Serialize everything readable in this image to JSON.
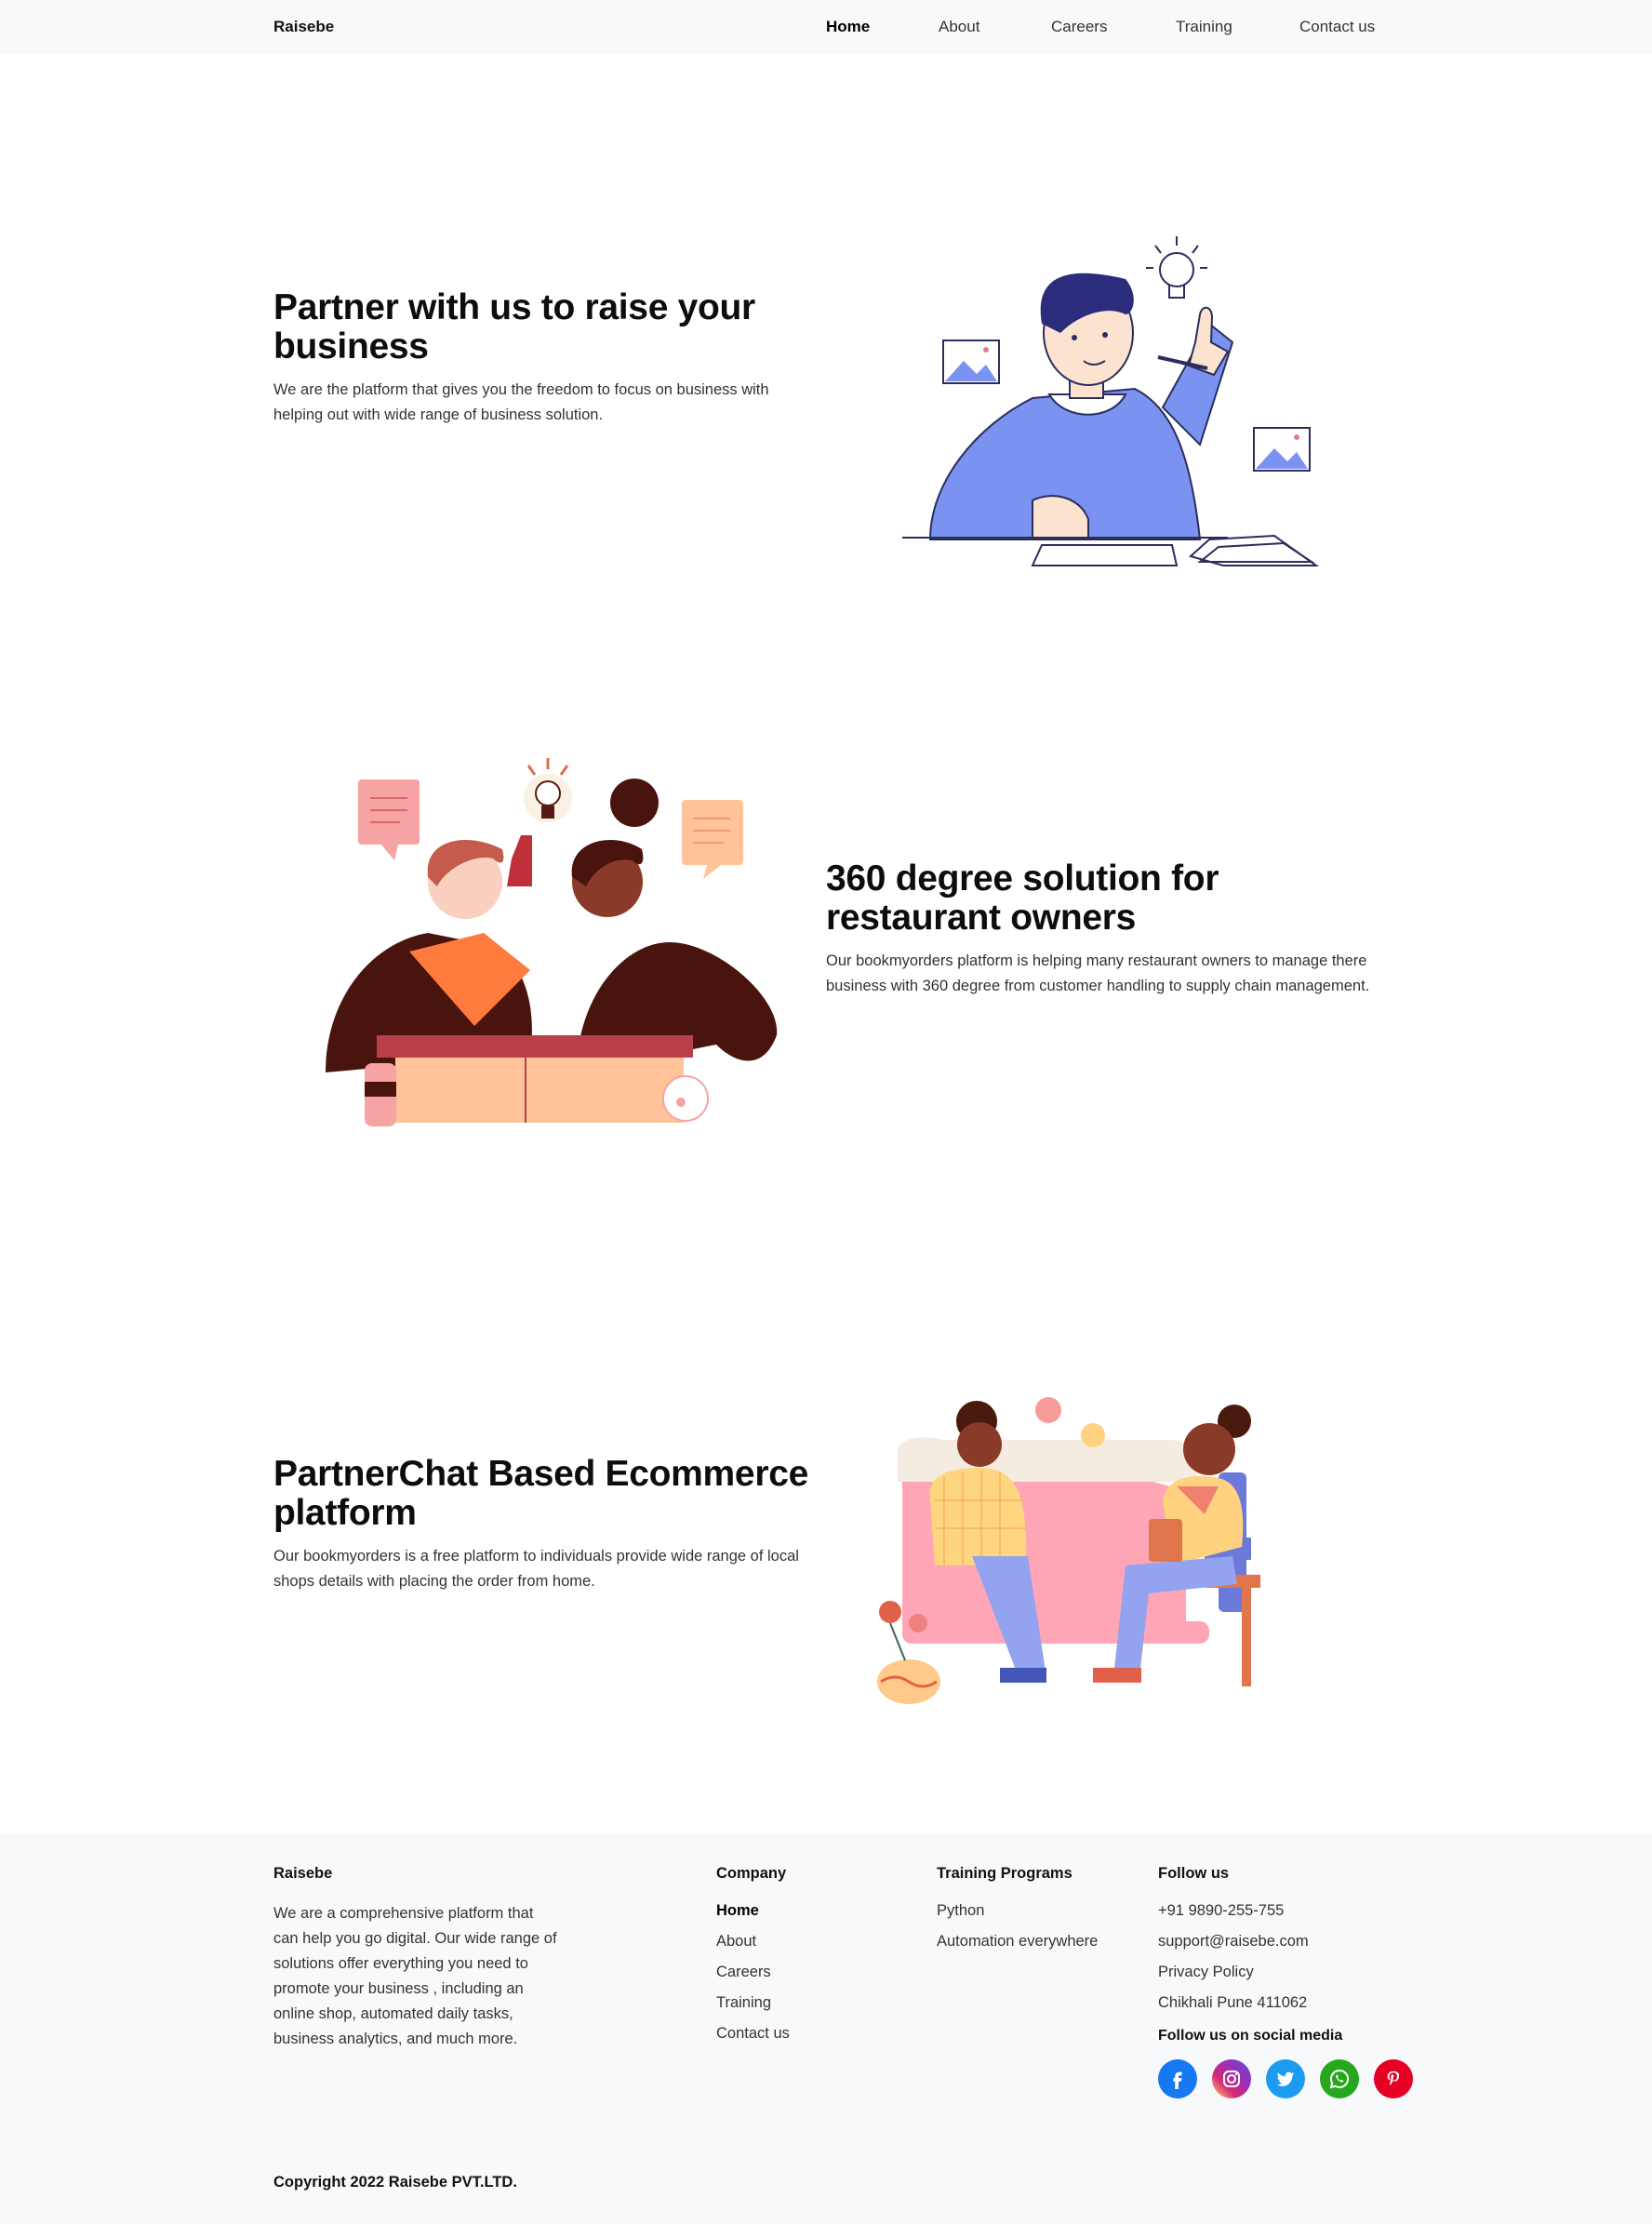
{
  "nav": {
    "brand": "Raisebe",
    "links": [
      {
        "label": "Home"
      },
      {
        "label": "About"
      },
      {
        "label": "Careers"
      },
      {
        "label": "Training"
      },
      {
        "label": "Contact us"
      }
    ]
  },
  "sections": [
    {
      "title": "Partner with us to raise your business",
      "description": "We are the platform that gives you the freedom to focus on business with helping out with wide range of business solution."
    },
    {
      "title": "360 degree solution for restaurant owners",
      "description": "Our bookmyorders platform is helping many restaurant owners to manage there business with 360 degree from customer handling to supply chain management."
    },
    {
      "title": "PartnerChat Based Ecommerce platform",
      "description": "Our bookmyorders is a free platform to individuals provide wide range of local shops details with placing the order from home."
    }
  ],
  "footer": {
    "brand": "Raisebe",
    "about": "We are a comprehensive platform that can help you go digital. Our wide range of solutions offer everything you need to promote your business , including an online shop, automated daily tasks, business analytics, and much more.",
    "company": {
      "heading": "Company",
      "items": [
        "Home",
        "About",
        "Careers",
        "Training",
        "Contact us"
      ]
    },
    "training": {
      "heading": "Training Programs",
      "items": [
        "Python",
        "Automation everywhere"
      ]
    },
    "follow": {
      "heading": "Follow us",
      "items": [
        "+91 9890-255-755",
        "support@raisebe.com",
        "Privacy Policy",
        "Chikhali Pune 411062"
      ],
      "social_heading": "Follow us on social media",
      "social": [
        {
          "icon": "facebook-icon",
          "color": "#1877f2"
        },
        {
          "icon": "instagram-icon",
          "color": "#d6249f"
        },
        {
          "icon": "twitter-icon",
          "color": "#1d9bf0"
        },
        {
          "icon": "whatsapp-icon",
          "color": "#25a81c"
        },
        {
          "icon": "pinterest-icon",
          "color": "#e60023"
        }
      ]
    },
    "copyright": "Copyright 2022 Raisebe PVT.LTD."
  }
}
